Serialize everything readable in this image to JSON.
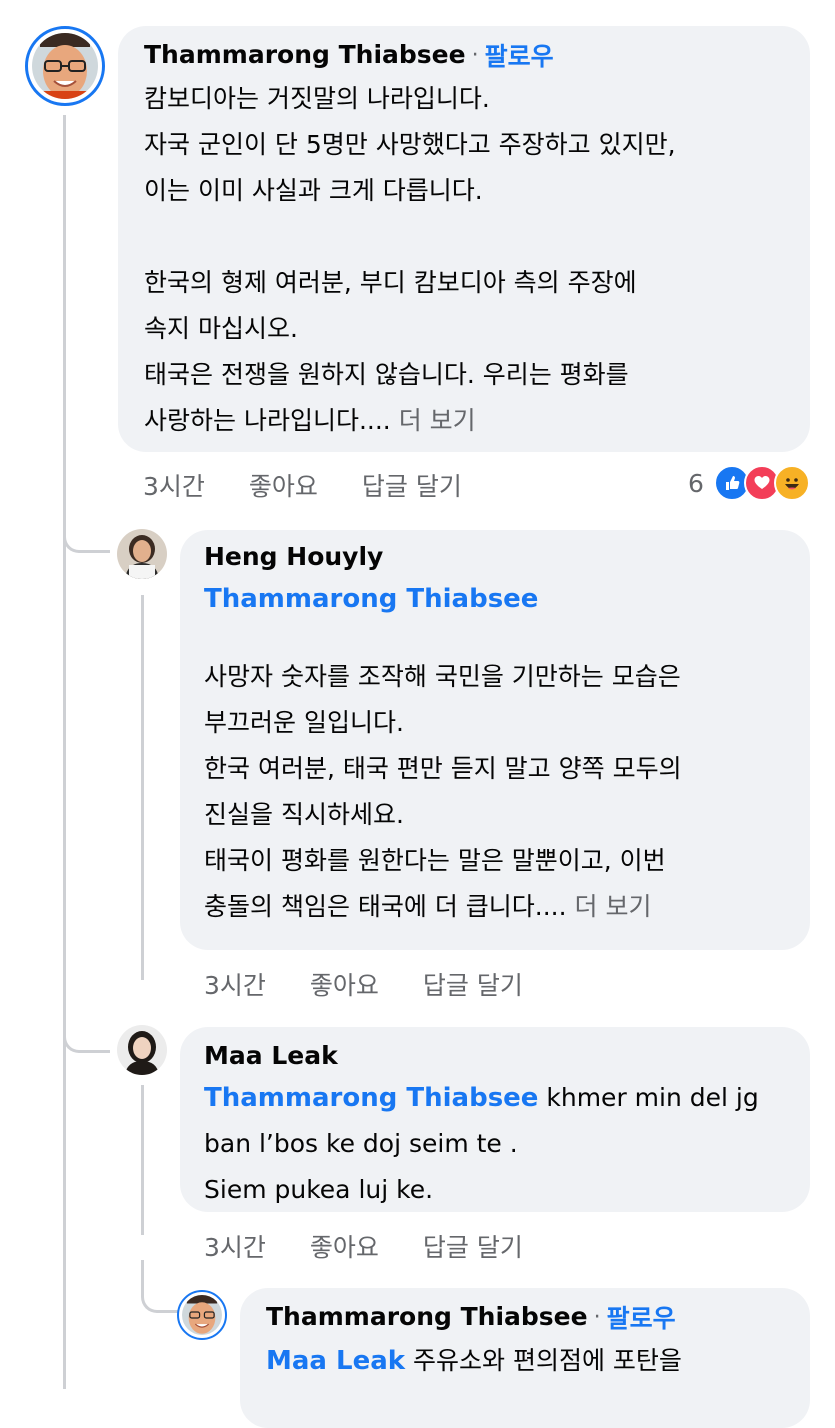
{
  "comments": [
    {
      "author": "Thammarong Thiabsee",
      "follow_label": "팔로우",
      "text": "캄보디아는 거짓말의 나라입니다.\n자국 군인이 단 5명만 사망했다고 주장하고 있지만,\n이는 이미 사실과 크게 다릅니다.\n\n한국의 형제 여러분, 부디 캄보디아 측의 주장에\n속지 마십시오.\n태국은 전쟁을 원하지 않습니다. 우리는 평화를\n사랑하는 나라입니다....",
      "see_more": " 더 보기",
      "time": "3시간",
      "like_label": "좋아요",
      "reply_label": "답글 달기",
      "reaction_count": "6",
      "reactions": [
        "like-reaction-icon",
        "love-reaction-icon",
        "haha-reaction-icon"
      ]
    },
    {
      "author": "Heng Houyly",
      "mention": "Thammarong Thiabsee",
      "text": "사망자 숫자를 조작해 국민을 기만하는 모습은\n부끄러운 일입니다.\n한국 여러분, 태국 편만 듣지 말고 양쪽 모두의\n진실을 직시하세요.\n태국이 평화를 원한다는 말은 말뿐이고, 이번\n충돌의 책임은 태국에 더 큽니다....",
      "see_more": " 더 보기",
      "time": "3시간",
      "like_label": "좋아요",
      "reply_label": "답글 달기"
    },
    {
      "author": "Maa Leak",
      "mention": "Thammarong Thiabsee",
      "text_first": " khmer min del jg",
      "text_rest": "ban l’bos ke doj seim te .\nSiem pukea luj ke.",
      "time": "3시간",
      "like_label": "좋아요",
      "reply_label": "답글 달기"
    },
    {
      "author": "Thammarong Thiabsee",
      "follow_label": "팔로우",
      "mention": "Maa Leak",
      "text": " 주유소와 편의점에 포탄을"
    }
  ],
  "colors": {
    "accent": "#1877f2",
    "bubble": "#f0f2f5",
    "meta": "#65676b"
  }
}
